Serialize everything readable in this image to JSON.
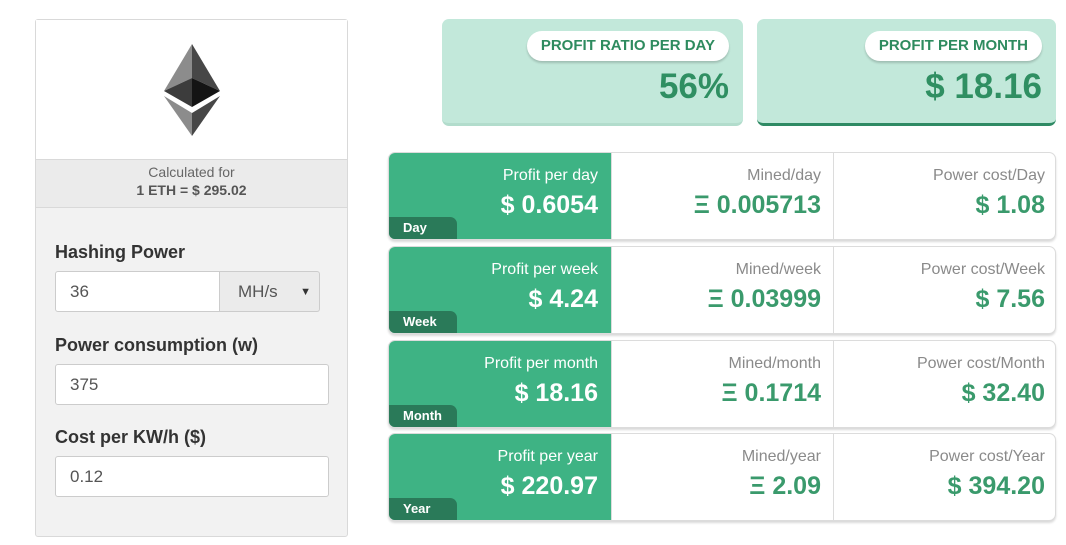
{
  "calc": {
    "label": "Calculated for",
    "rate": "1 ETH = $ 295.02"
  },
  "form": {
    "hashing_label": "Hashing Power",
    "hashing_value": "36",
    "hashing_unit": "MH/s",
    "power_label": "Power consumption (w)",
    "power_value": "375",
    "cost_label": "Cost per KW/h ($)",
    "cost_value": "0.12"
  },
  "summary": {
    "ratio_label": "PROFIT RATIO PER DAY",
    "ratio_value": "56%",
    "month_label": "PROFIT PER MONTH",
    "month_value": "$ 18.16"
  },
  "rows": [
    {
      "period": "Day",
      "profit_label": "Profit per day",
      "profit": "$ 0.6054",
      "mined_label": "Mined/day",
      "mined": "Ξ 0.005713",
      "power_label": "Power cost/Day",
      "power": "$ 1.08"
    },
    {
      "period": "Week",
      "profit_label": "Profit per week",
      "profit": "$ 4.24",
      "mined_label": "Mined/week",
      "mined": "Ξ 0.03999",
      "power_label": "Power cost/Week",
      "power": "$ 7.56"
    },
    {
      "period": "Month",
      "profit_label": "Profit per month",
      "profit": "$ 18.16",
      "mined_label": "Mined/month",
      "mined": "Ξ 0.1714",
      "power_label": "Power cost/Month",
      "power": "$ 32.40"
    },
    {
      "period": "Year",
      "profit_label": "Profit per year",
      "profit": "$ 220.97",
      "mined_label": "Mined/year",
      "mined": "Ξ 2.09",
      "power_label": "Power cost/Year",
      "power": "$ 394.20"
    }
  ],
  "colors": {
    "accent": "#3eb384",
    "accent_dark": "#2a7a59",
    "summary_bg": "#c2e8da",
    "value_green": "#3a9a6c"
  },
  "icons": {
    "logo": "ethereum-logo-icon",
    "caret": "caret-down-icon"
  }
}
